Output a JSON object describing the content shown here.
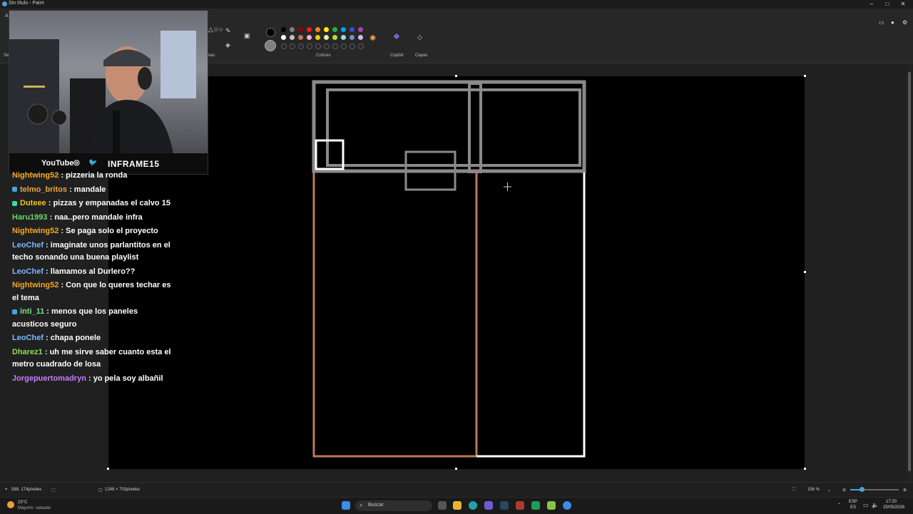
{
  "window": {
    "title": "Sin título - Paint",
    "minimize": "–",
    "maximize": "□",
    "close": "✕"
  },
  "toolbar": {
    "labels": {
      "colores": "Colores",
      "copilot": "Copilot",
      "capas": "Capas",
      "formas": "rmas",
      "archivo": "Ar",
      "sel": "Sel"
    },
    "palette_row1": [
      "#000000",
      "#7f7f7f",
      "#880015",
      "#ed1c24",
      "#ff7f27",
      "#fff200",
      "#22b14c",
      "#00a2e8",
      "#3f48cc",
      "#a349a4"
    ],
    "palette_row2": [
      "#ffffff",
      "#c3c3c3",
      "#b97a57",
      "#ffaec9",
      "#ffc90e",
      "#efe4b0",
      "#b5e61d",
      "#99d9ea",
      "#7092be",
      "#c8bfe7"
    ],
    "primary_color": "#000000",
    "secondary_color": "#808080",
    "icons": [
      "pencil-icon",
      "shapes-icon",
      "select-icon",
      "palette-icon",
      "copilot-icon",
      "layers-icon"
    ]
  },
  "webcam": {
    "social_label": "YouTube",
    "channel": "INFRAME15",
    "icons": [
      "instagram-icon",
      "twitter-icon"
    ]
  },
  "chat": [
    {
      "user": "Nightwing52",
      "color": "#f5a623",
      "text": "pizzeria la ronda"
    },
    {
      "user": "telmo_britos",
      "color": "#e8a64a",
      "badge": "#4aa3df",
      "text": "mandale"
    },
    {
      "user": "Duteee",
      "color": "#f0c419",
      "badge": "#3fd4b4",
      "text": "pizzas y empanadas el calvo 15"
    },
    {
      "user": "Haru1993",
      "color": "#6ed46e",
      "text": "naa..pero mandale infra"
    },
    {
      "user": "Nightwing52",
      "color": "#f5a623",
      "text": "Se paga solo el proyecto"
    },
    {
      "user": "LeoChef",
      "color": "#7ab8ff",
      "text": "imaginate unos parlantitos en el techo sonando una buena playlist"
    },
    {
      "user": "LeoChef",
      "color": "#7ab8ff",
      "text": "llamamos al Durlero??"
    },
    {
      "user": "Nightwing52",
      "color": "#f5a623",
      "text": "Con que lo queres techar es el tema"
    },
    {
      "user": "inti_11",
      "color": "#7be08a",
      "badge": "#4aa3df",
      "text": "menos que los paneles acusticos seguro"
    },
    {
      "user": "LeoChef",
      "color": "#7ab8ff",
      "text": "chapa ponele"
    },
    {
      "user": "Dharez1",
      "color": "#8be04e",
      "text": "uh me sirve saber cuanto esta el metro cuadrado de losa"
    },
    {
      "user": "Jorgepuertomadryn",
      "color": "#c77dff",
      "text": "yo pela soy albañil"
    }
  ],
  "drawing": {
    "colors": {
      "gray": "#8a8a8a",
      "white": "#ffffff",
      "brown": "#b97a57"
    }
  },
  "statusbar": {
    "cursor_pos": "589, 174píxeles",
    "canvas_size": "1248 × 703píxeles",
    "zoom": "156 %"
  },
  "taskbar": {
    "search_label": "Buscar",
    "weather_temp": "23°C",
    "weather_desc": "Mayorm. soleado",
    "lang_top": "ESP",
    "lang_bottom": "ES",
    "time": "17:20",
    "date": "25/05/2026"
  }
}
